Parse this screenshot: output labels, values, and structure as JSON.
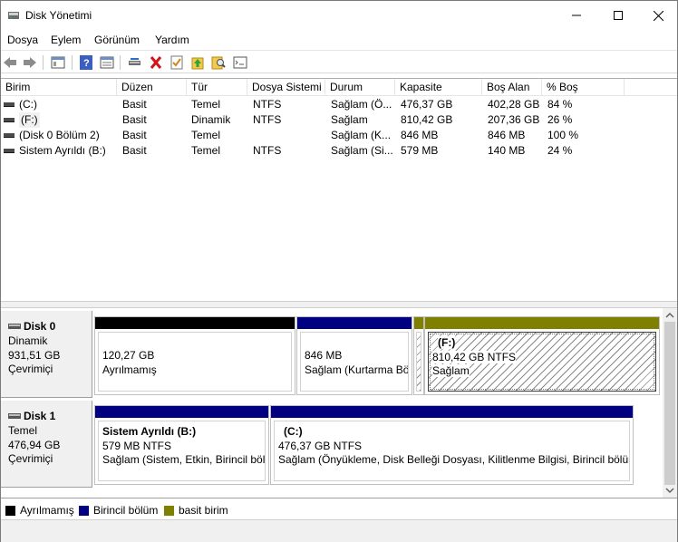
{
  "window": {
    "title": "Disk Yönetimi"
  },
  "menu": [
    "Dosya",
    "Eylem",
    "Görünüm",
    "Yardım"
  ],
  "toolbar": {
    "icons": [
      "back-arrow-icon",
      "forward-arrow-icon",
      "console-tree-icon",
      "help-icon",
      "properties-icon",
      "connect-icon",
      "delete-icon",
      "check-icon",
      "import-icon",
      "search-icon",
      "settings-list-icon"
    ]
  },
  "columns": [
    "Birim",
    "Düzen",
    "Tür",
    "Dosya Sistemi",
    "Durum",
    "Kapasite",
    "Boş Alan",
    "% Boş"
  ],
  "volumes": [
    {
      "birim": "(C:)",
      "duzen": "Basit",
      "tur": "Temel",
      "fs": "NTFS",
      "durum": "Sağlam (Ö...",
      "kapasite": "476,37 GB",
      "bos": "402,28 GB",
      "yuzde": "84 %"
    },
    {
      "birim": "(F:)",
      "duzen": "Basit",
      "tur": "Dinamik",
      "fs": "NTFS",
      "durum": "Sağlam",
      "kapasite": "810,42 GB",
      "bos": "207,36 GB",
      "yuzde": "26 %"
    },
    {
      "birim": "(Disk 0 Bölüm 2)",
      "duzen": "Basit",
      "tur": "Temel",
      "fs": "",
      "durum": "Sağlam (K...",
      "kapasite": "846 MB",
      "bos": "846 MB",
      "yuzde": "100 %"
    },
    {
      "birim": "Sistem Ayrıldı (B:)",
      "duzen": "Basit",
      "tur": "Temel",
      "fs": "NTFS",
      "durum": "Sağlam (Si...",
      "kapasite": "579 MB",
      "bos": "140 MB",
      "yuzde": "24 %"
    }
  ],
  "disks": [
    {
      "name": "Disk 0",
      "type": "Dinamik",
      "size": "931,51 GB",
      "state": "Çevrimiçi",
      "parts": [
        {
          "line1": "120,27 GB",
          "line2": "Ayrılmamış"
        },
        {
          "line1": "846 MB",
          "line2": "Sağlam (Kurtarma Bö"
        },
        {
          "title": "(F:)",
          "line1": "810,42 GB NTFS",
          "line2": "Sağlam"
        }
      ]
    },
    {
      "name": "Disk 1",
      "type": "Temel",
      "size": "476,94 GB",
      "state": "Çevrimiçi",
      "parts": [
        {
          "title": "Sistem Ayrıldı  (B:)",
          "line1": "579 MB NTFS",
          "line2": "Sağlam (Sistem, Etkin, Birincil bölü"
        },
        {
          "title": "(C:)",
          "line1": "476,37 GB NTFS",
          "line2": "Sağlam (Önyükleme, Disk Belleği Dosyası, Kilitlenme Bilgisi, Birincil bölün"
        }
      ]
    }
  ],
  "legend": [
    {
      "label": "Ayrılmamış",
      "color": "#000000"
    },
    {
      "label": "Birincil bölüm",
      "color": "#000080"
    },
    {
      "label": "basit birim",
      "color": "#808000"
    }
  ],
  "colors": {
    "unallocated": "#000000",
    "primary": "#000080",
    "simple": "#808000"
  }
}
